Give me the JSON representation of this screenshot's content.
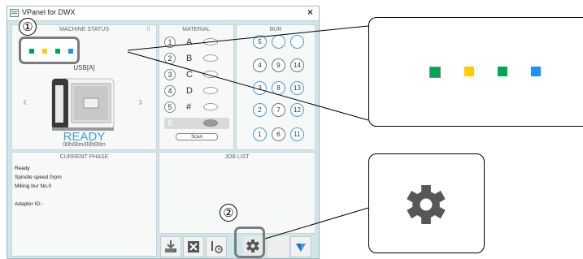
{
  "window": {
    "title": "VPanel for DWX",
    "close_label": "×"
  },
  "machine_status": {
    "header": "MACHINE STATUS",
    "status_colors": [
      "#00a651",
      "#ffcc00",
      "#00a651",
      "#1e90ff"
    ],
    "connection": "USB[A]",
    "state": "READY",
    "elapsed": "00h00m/00h00m"
  },
  "material": {
    "header": "MATERIAL",
    "slots": [
      {
        "num": "1",
        "label": "A"
      },
      {
        "num": "2",
        "label": "B"
      },
      {
        "num": "3",
        "label": "C"
      },
      {
        "num": "4",
        "label": "D"
      },
      {
        "num": "5",
        "label": "#"
      },
      {
        "num": "6",
        "label": ""
      }
    ],
    "scan_label": "Scan"
  },
  "bur": {
    "header": "BUR",
    "items": [
      "5",
      "",
      "",
      "4",
      "9",
      "14",
      "3",
      "8",
      "13",
      "2",
      "7",
      "12",
      "1",
      "6",
      "11"
    ]
  },
  "current_phase": {
    "header": "CURRENT PHASE",
    "lines": [
      "Ready",
      "Spindle speed  0rpm",
      "Milling bur  No.0",
      "",
      "Adapter  ID:-"
    ]
  },
  "job_list": {
    "header": "JOB LIST"
  },
  "callouts": {
    "one": "①",
    "two": "②"
  },
  "icons": [
    "app-window-icon",
    "close-icon",
    "machine-icon",
    "chevron-left-icon",
    "chevron-right-icon",
    "output-icon",
    "delete-icon",
    "schedule-icon",
    "gear-icon",
    "vpanel-logo-icon"
  ]
}
